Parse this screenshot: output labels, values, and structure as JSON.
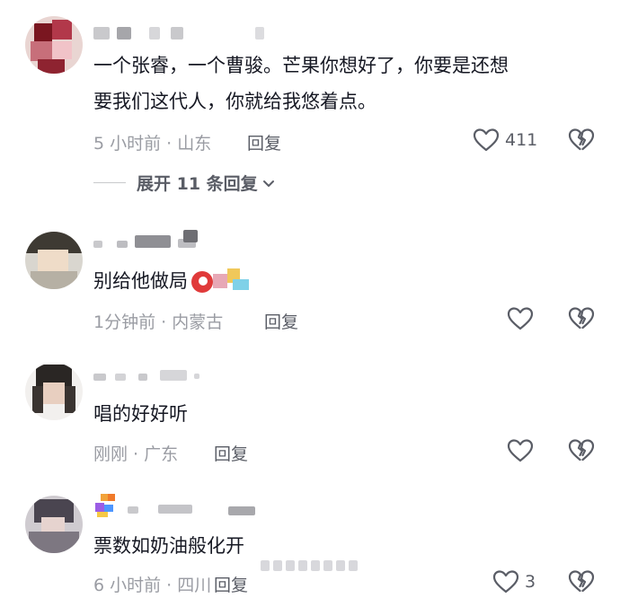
{
  "comments": [
    {
      "text_lines": [
        "一个张睿，一个曹骏。芒果你想好了，你要是还想",
        "要我们这代人，你就给我悠着点。"
      ],
      "meta": "5 小时前 · 山东",
      "reply_label": "回复",
      "like_count": "411",
      "expand_label": "展开 11 条回复"
    },
    {
      "text": "别给他做局",
      "meta": "1分钟前 · 内蒙古",
      "reply_label": "回复",
      "like_count": ""
    },
    {
      "text": "唱的好好听",
      "meta": "刚刚 · 广东",
      "reply_label": "回复",
      "like_count": ""
    },
    {
      "text": "票数如奶油般化开",
      "meta": "6 小时前 · 四川",
      "reply_label": "回复",
      "like_count": "3"
    }
  ],
  "colors": {
    "text_primary": "#161823",
    "text_secondary": "#9a9ca3",
    "action_text": "#5a5d66",
    "icon_stroke": "#5a5d66"
  },
  "icons": [
    "heart-icon",
    "broken-heart-icon",
    "chevron-down-icon"
  ]
}
